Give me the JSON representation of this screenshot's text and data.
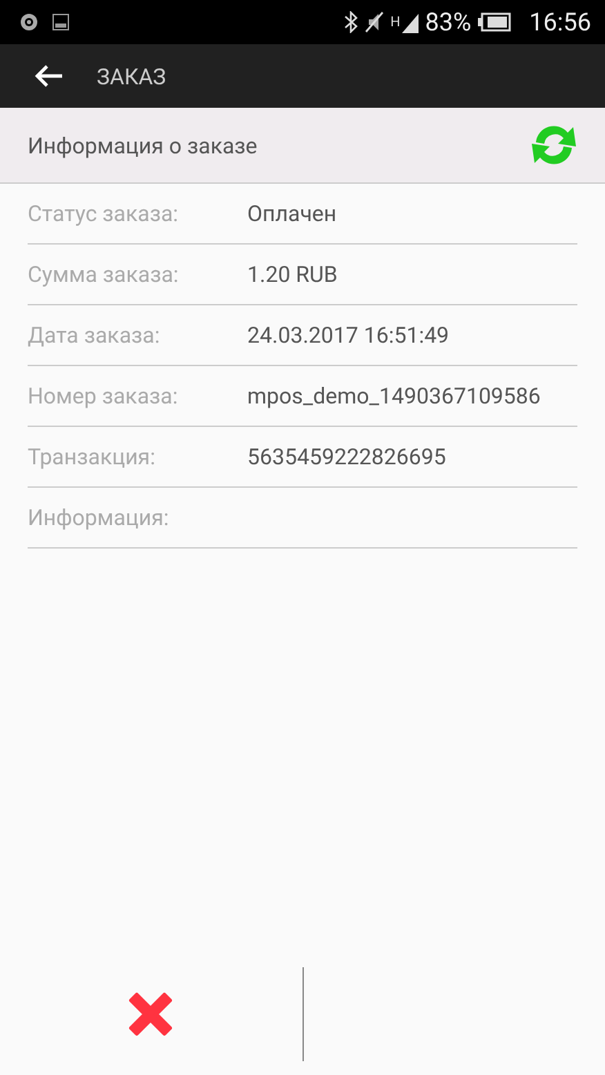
{
  "status_bar": {
    "network_type": "H",
    "battery": "83%",
    "time": "16:56"
  },
  "toolbar": {
    "title": "ЗАКАЗ"
  },
  "section": {
    "title": "Информация о заказе"
  },
  "fields": [
    {
      "label": "Статус заказа:",
      "value": "Оплачен"
    },
    {
      "label": "Сумма заказа:",
      "value": "1.20 RUB"
    },
    {
      "label": "Дата заказа:",
      "value": "24.03.2017 16:51:49"
    },
    {
      "label": "Номер заказа:",
      "value": "mpos_demo_1490367109586"
    },
    {
      "label": "Транзакция:",
      "value": "5635459222826695"
    },
    {
      "label": "Информация:"
    }
  ]
}
